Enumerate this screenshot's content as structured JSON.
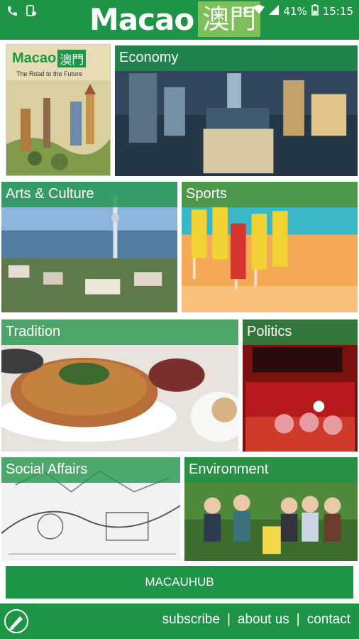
{
  "status_bar": {
    "left_icons": [
      "phone-wifi-icon",
      "phone-settings-icon"
    ],
    "battery": "41%",
    "time": "15:15"
  },
  "brand": {
    "latin": "Macao",
    "cjk": "澳門"
  },
  "cover": {
    "latin": "Macao",
    "cjk": "澳門",
    "subtitle": "The Road to the Future"
  },
  "tiles": {
    "economy": "Economy",
    "arts": "Arts & Culture",
    "sports": "Sports",
    "tradition": "Tradition",
    "politics": "Politics",
    "social": "Social Affairs",
    "environment": "Environment"
  },
  "hub_button": "MACAUHUB",
  "footer": {
    "subscribe": "subscribe",
    "about": "about us",
    "contact": "contact",
    "sep": "|"
  },
  "colors": {
    "brand_green": "#1e9447",
    "cjk_green": "#7dbf5a"
  }
}
